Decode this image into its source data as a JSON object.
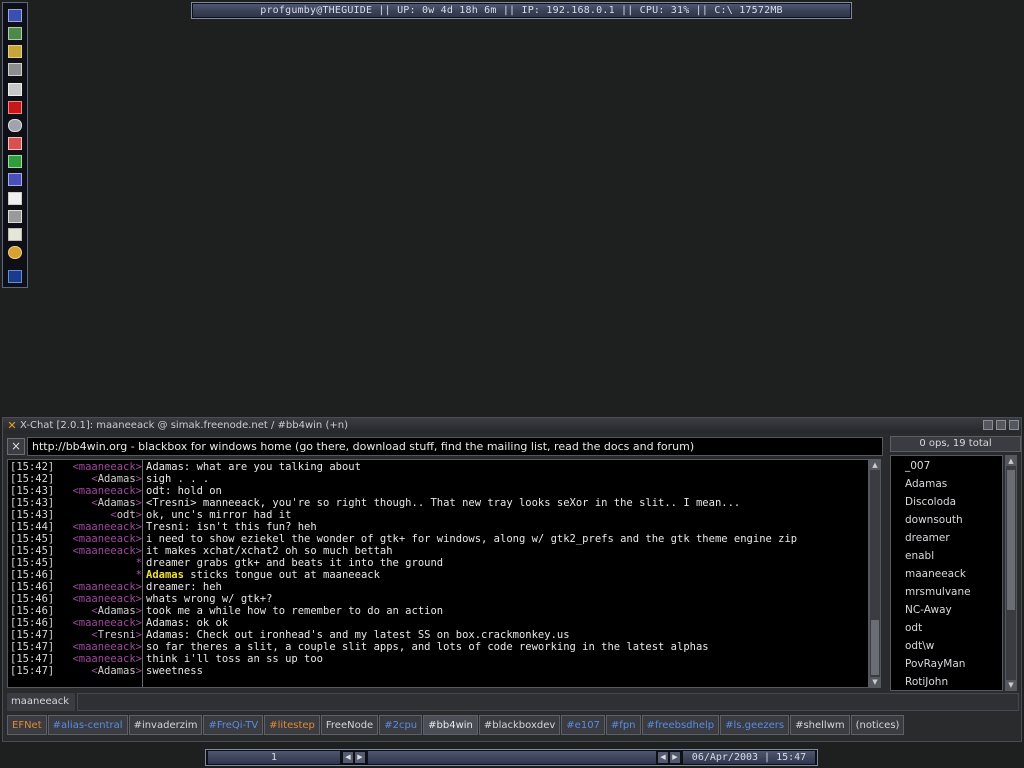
{
  "top_status_bar": {
    "text": "profgumby@THEGUIDE || UP: 0w 4d 18h 6m || IP: 192.168.0.1 || CPU: 31% || C:\\ 17572MB"
  },
  "toolbar": {
    "icons": [
      "shield-icon",
      "globe-icon",
      "speaker-icon",
      "network-icon",
      "monitor-icon",
      "ati-icon",
      "eye-icon",
      "book-icon",
      "tree-icon",
      "molecule-icon",
      "document-icon",
      "computers-icon",
      "notepad-icon",
      "hand-icon",
      "tray-icon"
    ]
  },
  "window": {
    "title": "X-Chat [2.0.1]: maaneeack @ simak.freenode.net / #bb4win (+n)",
    "close_label": "×",
    "topic": "http://bb4win.org - blackbox for windows home (go there, download stuff, find the mailing list, read the docs and forum)",
    "ops_count": "0 ops, 19 total",
    "nick": "maaneeack",
    "input_value": ""
  },
  "messages": [
    {
      "time": "[15:42]",
      "nick": "maaneeack",
      "nick_color": "#a0479e",
      "text": "Adamas: what are you talking about"
    },
    {
      "time": "[15:42]",
      "nick": "Adamas",
      "nick_color": "#d0d0d0",
      "text": "sigh . . ."
    },
    {
      "time": "[15:43]",
      "nick": "maaneeack",
      "nick_color": "#a0479e",
      "text": "odt: hold on"
    },
    {
      "time": "[15:43]",
      "nick": "Adamas",
      "nick_color": "#d0d0d0",
      "text": "<Tresni> manneeack, you're so right though..  That new tray looks seXor in the slit..  I mean..."
    },
    {
      "time": "[15:43]",
      "nick": "odt",
      "nick_color": "#d0d0d0",
      "text": "ok, unc's mirror had it"
    },
    {
      "time": "[15:44]",
      "nick": "maaneeack",
      "nick_color": "#a0479e",
      "text": "Tresni: isn't this fun? heh"
    },
    {
      "time": "[15:45]",
      "nick": "maaneeack",
      "nick_color": "#a0479e",
      "text": "i need to show eziekel the wonder of gtk+ for windows, along w/ gtk2_prefs and the gtk theme engine zip"
    },
    {
      "time": "[15:45]",
      "nick": "maaneeack",
      "nick_color": "#a0479e",
      "text": "it makes xchat/xchat2 oh so much bettah"
    },
    {
      "time": "[15:45]",
      "action": true,
      "text": "dreamer grabs gtk+ and beats it into the ground"
    },
    {
      "time": "[15:46]",
      "action": true,
      "actor": "Adamas",
      "text": " sticks tongue out at maaneeack"
    },
    {
      "time": "[15:46]",
      "nick": "maaneeack",
      "nick_color": "#a0479e",
      "text": "dreamer: heh"
    },
    {
      "time": "[15:46]",
      "nick": "maaneeack",
      "nick_color": "#a0479e",
      "text": "whats wrong w/ gtk+?"
    },
    {
      "time": "[15:46]",
      "nick": "Adamas",
      "nick_color": "#d0d0d0",
      "text": "took me a while how to remember to do an action"
    },
    {
      "time": "[15:46]",
      "nick": "maaneeack",
      "nick_color": "#a0479e",
      "text": "Adamas: ok ok"
    },
    {
      "time": "[15:47]",
      "nick": "Tresni",
      "nick_color": "#d0d0d0",
      "text": "Adamas: Check out ironhead's and my latest SS on box.crackmonkey.us"
    },
    {
      "time": "[15:47]",
      "nick": "maaneeack",
      "nick_color": "#a0479e",
      "text": "so far theres a slit, a couple slit apps, and lots of code reworking in the latest alphas"
    },
    {
      "time": "[15:47]",
      "nick": "maaneeack",
      "nick_color": "#a0479e",
      "text": "think i'll toss an ss up too"
    },
    {
      "time": "[15:47]",
      "nick": "Adamas",
      "nick_color": "#d0d0d0",
      "text": "sweetness"
    }
  ],
  "users": [
    "_007",
    "Adamas",
    "Discoloda",
    "downsouth",
    "dreamer",
    "enabl",
    "maaneeack",
    "mrsmulvane",
    "NC-Away",
    "odt",
    "odt\\w",
    "PovRayMan",
    "RotiJohn"
  ],
  "tabs": [
    {
      "label": "EFNet",
      "style": "orange"
    },
    {
      "label": "#alias-central",
      "style": "blue"
    },
    {
      "label": "#invaderzim",
      "style": "normal"
    },
    {
      "label": "#FreQi-TV",
      "style": "blue"
    },
    {
      "label": "#litestep",
      "style": "orange"
    },
    {
      "label": "FreeNode",
      "style": "normal"
    },
    {
      "label": "#2cpu",
      "style": "blue"
    },
    {
      "label": "#bb4win",
      "style": "active"
    },
    {
      "label": "#blackboxdev",
      "style": "normal"
    },
    {
      "label": "#e107",
      "style": "blue"
    },
    {
      "label": "#fpn",
      "style": "blue"
    },
    {
      "label": "#freebsdhelp",
      "style": "blue"
    },
    {
      "label": "#ls.geezers",
      "style": "blue"
    },
    {
      "label": "#shellwm",
      "style": "normal"
    },
    {
      "label": "(notices)",
      "style": "normal"
    }
  ],
  "taskbar": {
    "workspace": "1",
    "clock": "06/Apr/2003 | 15:47"
  }
}
